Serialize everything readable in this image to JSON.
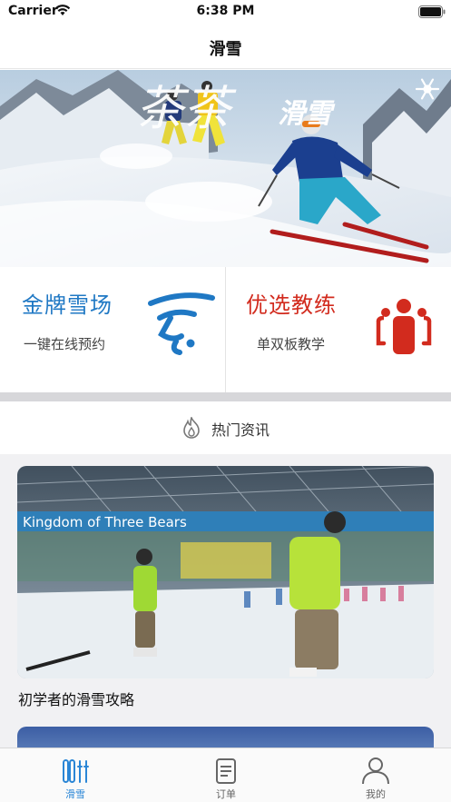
{
  "status_bar": {
    "carrier": "Carrier",
    "time": "6:38 PM"
  },
  "nav": {
    "title": "滑雪"
  },
  "banner": {
    "logo_text": "茶茶滑雪"
  },
  "features": [
    {
      "title": "金牌雪场",
      "subtitle": "一键在线预约",
      "color": "#1f78c4",
      "icon": "skier-icon"
    },
    {
      "title": "优选教练",
      "subtitle": "单双板教学",
      "color": "#d22b1e",
      "icon": "coach-group-icon"
    }
  ],
  "hot_news": {
    "label": "热门资讯",
    "icon": "fire-icon"
  },
  "news": [
    {
      "title": "初学者的滑雪攻略",
      "image_sign": "Kingdom of Three Bears"
    }
  ],
  "tabbar": {
    "items": [
      {
        "label": "滑雪",
        "icon": "ski-icon",
        "active": true
      },
      {
        "label": "订单",
        "icon": "order-icon",
        "active": false
      },
      {
        "label": "我的",
        "icon": "user-icon",
        "active": false
      }
    ]
  },
  "colors": {
    "accent": "#2a86d6",
    "blue": "#1f78c4",
    "red": "#d22b1e"
  }
}
